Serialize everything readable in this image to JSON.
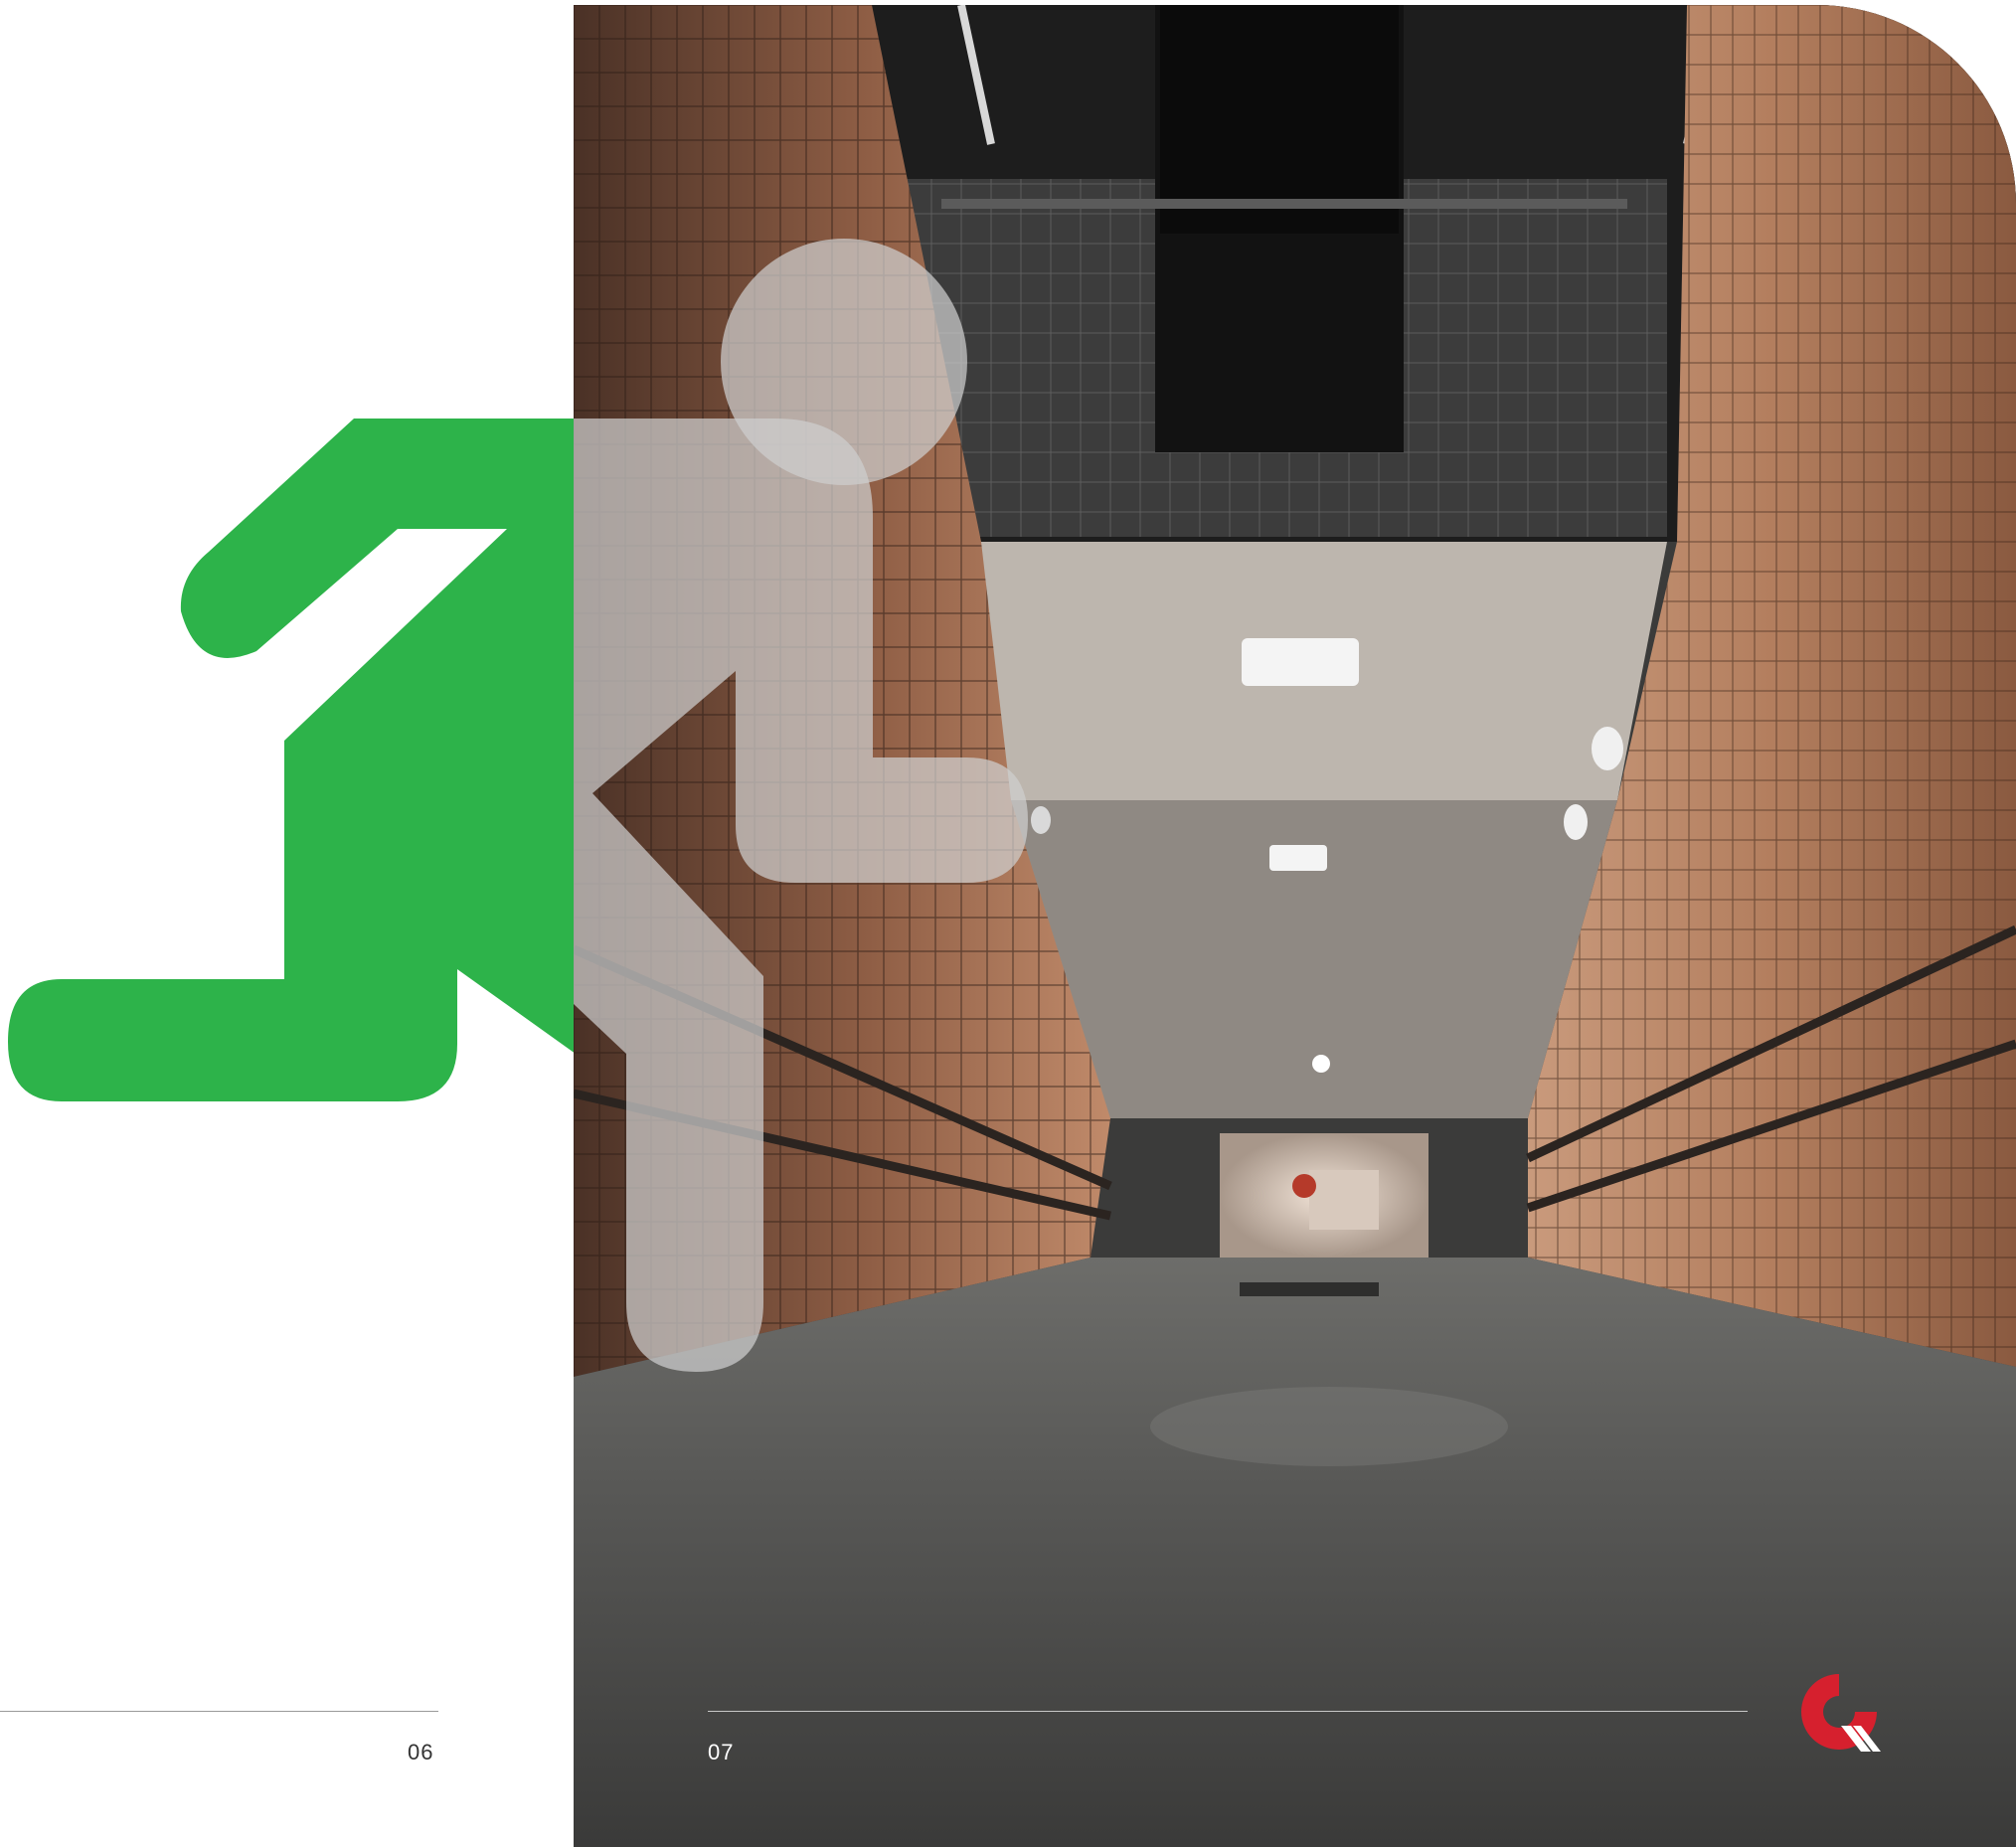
{
  "spread": {
    "left_page_number": "06",
    "right_page_number": "07"
  },
  "colors": {
    "accent_green": "#2db34a",
    "figure_overlay": "#bfbfbf",
    "logo_red": "#d6202e",
    "page_background": "#ffffff"
  },
  "icons": {
    "figure": "running-person-exit-icon",
    "logo": "brand-logo-icon"
  },
  "photo": {
    "subject": "underground-pedestrian-tunnel"
  }
}
